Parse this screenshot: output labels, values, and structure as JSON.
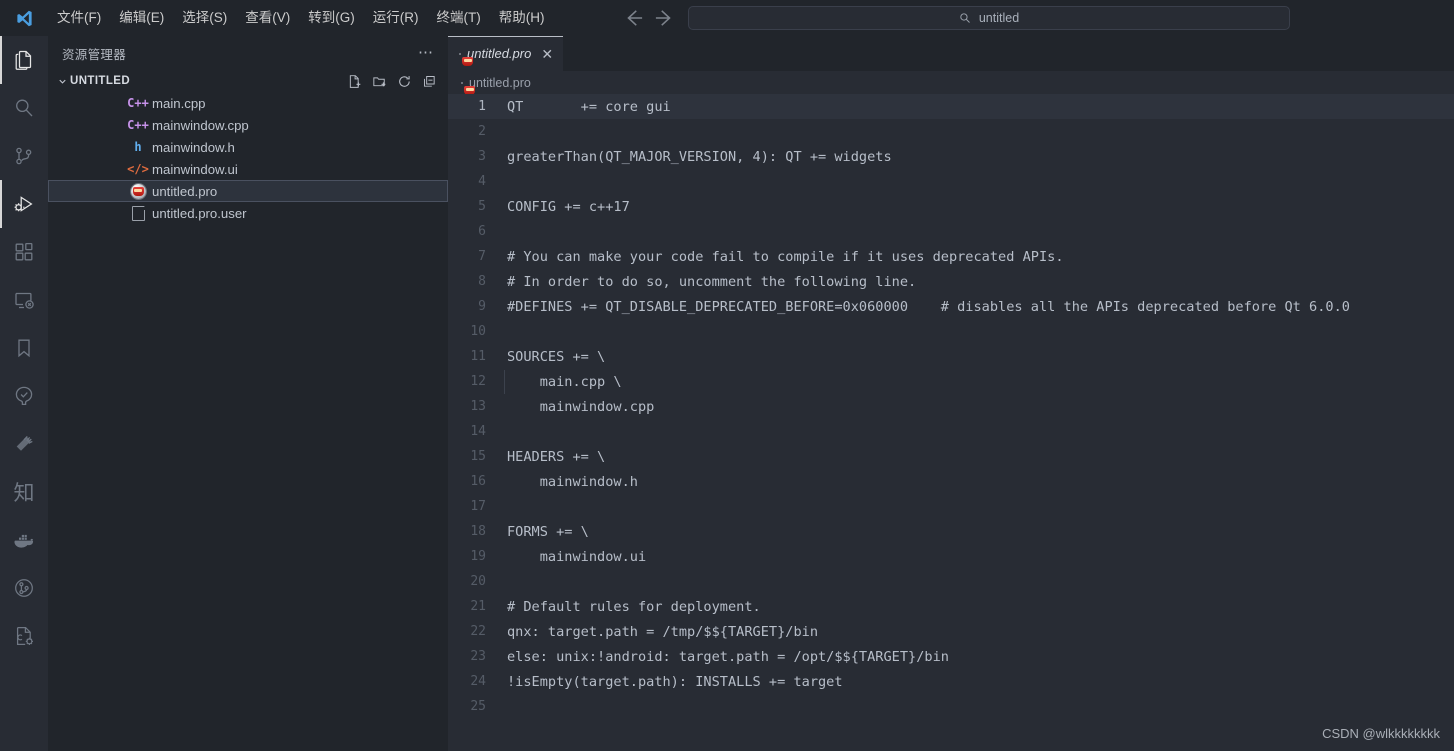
{
  "titlebar": {
    "logo_icon": "vscode-logo-icon",
    "menus": [
      {
        "label": "文件(F)",
        "mnemonic": "F"
      },
      {
        "label": "编辑(E)",
        "mnemonic": "E"
      },
      {
        "label": "选择(S)",
        "mnemonic": "S"
      },
      {
        "label": "查看(V)",
        "mnemonic": "V"
      },
      {
        "label": "转到(G)",
        "mnemonic": "G"
      },
      {
        "label": "运行(R)",
        "mnemonic": "R"
      },
      {
        "label": "终端(T)",
        "mnemonic": "T"
      },
      {
        "label": "帮助(H)",
        "mnemonic": "H"
      }
    ],
    "nav_back_icon": "arrow-left-icon",
    "nav_forward_icon": "arrow-right-icon",
    "command_center": {
      "icon": "search-icon",
      "text": "untitled"
    }
  },
  "activitybar": {
    "items": [
      {
        "name": "explorer",
        "icon": "files-icon",
        "active": true
      },
      {
        "name": "search",
        "icon": "search-icon",
        "active": false
      },
      {
        "name": "source-control",
        "icon": "source-control-icon",
        "active": false
      },
      {
        "name": "run-and-debug",
        "icon": "run-debug-icon",
        "active": false
      },
      {
        "name": "extensions",
        "icon": "extensions-icon",
        "active": false
      },
      {
        "name": "remote-explorer",
        "icon": "remote-explorer-icon",
        "active": false
      },
      {
        "name": "bookmarks",
        "icon": "bookmark-icon",
        "active": false
      },
      {
        "name": "testing",
        "icon": "beaker-check-icon",
        "active": false
      },
      {
        "name": "build-tools",
        "icon": "hammer-icon",
        "active": false
      },
      {
        "name": "zhihu",
        "icon": "zhi-character-icon",
        "glyph": "知",
        "active": false
      },
      {
        "name": "docker",
        "icon": "docker-whale-icon",
        "active": false
      },
      {
        "name": "git-graph",
        "icon": "git-graph-circle-icon",
        "active": false
      },
      {
        "name": "cpp-tools",
        "icon": "cpp-file-gear-icon",
        "active": false
      }
    ]
  },
  "sidebar": {
    "title": "资源管理器",
    "more_actions_icon": "ellipsis-icon",
    "section": {
      "name": "UNTITLED",
      "chevron_icon": "chevron-down-icon",
      "actions": [
        {
          "name": "new-file",
          "icon": "new-file-icon"
        },
        {
          "name": "new-folder",
          "icon": "new-folder-icon"
        },
        {
          "name": "refresh",
          "icon": "refresh-icon"
        },
        {
          "name": "collapse-all",
          "icon": "collapse-all-icon"
        }
      ]
    },
    "files": [
      {
        "name": "main.cpp",
        "icon": "cpp-icon",
        "glyph": "C++",
        "selected": false
      },
      {
        "name": "mainwindow.cpp",
        "icon": "cpp-icon",
        "glyph": "C++",
        "selected": false
      },
      {
        "name": "mainwindow.h",
        "icon": "header-icon",
        "glyph": "h",
        "selected": false
      },
      {
        "name": "mainwindow.ui",
        "icon": "xml-icon",
        "glyph": "</>",
        "selected": false
      },
      {
        "name": "untitled.pro",
        "icon": "qt-project-icon",
        "glyph": "",
        "selected": true
      },
      {
        "name": "untitled.pro.user",
        "icon": "generic-file-icon",
        "glyph": "",
        "selected": false
      }
    ]
  },
  "editor": {
    "tab": {
      "label": "untitled.pro",
      "icon": "qt-project-icon",
      "close_icon": "close-icon",
      "active": true,
      "preview_italic": true
    },
    "breadcrumb": {
      "icon": "qt-project-icon",
      "label": "untitled.pro"
    },
    "active_line": 1,
    "lines": [
      {
        "n": "1",
        "text": "QT       += core gui",
        "indent": false
      },
      {
        "n": "2",
        "text": "",
        "indent": false
      },
      {
        "n": "3",
        "text": "greaterThan(QT_MAJOR_VERSION, 4): QT += widgets",
        "indent": false
      },
      {
        "n": "4",
        "text": "",
        "indent": false
      },
      {
        "n": "5",
        "text": "CONFIG += c++17",
        "indent": false
      },
      {
        "n": "6",
        "text": "",
        "indent": false
      },
      {
        "n": "7",
        "text": "# You can make your code fail to compile if it uses deprecated APIs.",
        "indent": false
      },
      {
        "n": "8",
        "text": "# In order to do so, uncomment the following line.",
        "indent": false
      },
      {
        "n": "9",
        "text": "#DEFINES += QT_DISABLE_DEPRECATED_BEFORE=0x060000    # disables all the APIs deprecated before Qt 6.0.0",
        "indent": false
      },
      {
        "n": "10",
        "text": "",
        "indent": false
      },
      {
        "n": "11",
        "text": "SOURCES += \\",
        "indent": false
      },
      {
        "n": "12",
        "text": "    main.cpp \\",
        "indent": true
      },
      {
        "n": "13",
        "text": "    mainwindow.cpp",
        "indent": true
      },
      {
        "n": "14",
        "text": "",
        "indent": false
      },
      {
        "n": "15",
        "text": "HEADERS += \\",
        "indent": false
      },
      {
        "n": "16",
        "text": "    mainwindow.h",
        "indent": true
      },
      {
        "n": "17",
        "text": "",
        "indent": false
      },
      {
        "n": "18",
        "text": "FORMS += \\",
        "indent": false
      },
      {
        "n": "19",
        "text": "    mainwindow.ui",
        "indent": true
      },
      {
        "n": "20",
        "text": "",
        "indent": false
      },
      {
        "n": "21",
        "text": "# Default rules for deployment.",
        "indent": false
      },
      {
        "n": "22",
        "text": "qnx: target.path = /tmp/$${TARGET}/bin",
        "indent": false
      },
      {
        "n": "23",
        "text": "else: unix:!android: target.path = /opt/$${TARGET}/bin",
        "indent": false
      },
      {
        "n": "24",
        "text": "!isEmpty(target.path): INSTALLS += target",
        "indent": false
      },
      {
        "n": "25",
        "text": "",
        "indent": false
      }
    ]
  },
  "watermark": "CSDN @wlkkkkkkkk",
  "colors": {
    "editor_bg": "#282c34",
    "sidebar_bg": "#21252b",
    "titlebar_bg": "#21252b",
    "accent_blue": "#61afef",
    "cpp_purple": "#c792ea",
    "ui_orange": "#e06c3f",
    "text": "#b7bec9"
  }
}
